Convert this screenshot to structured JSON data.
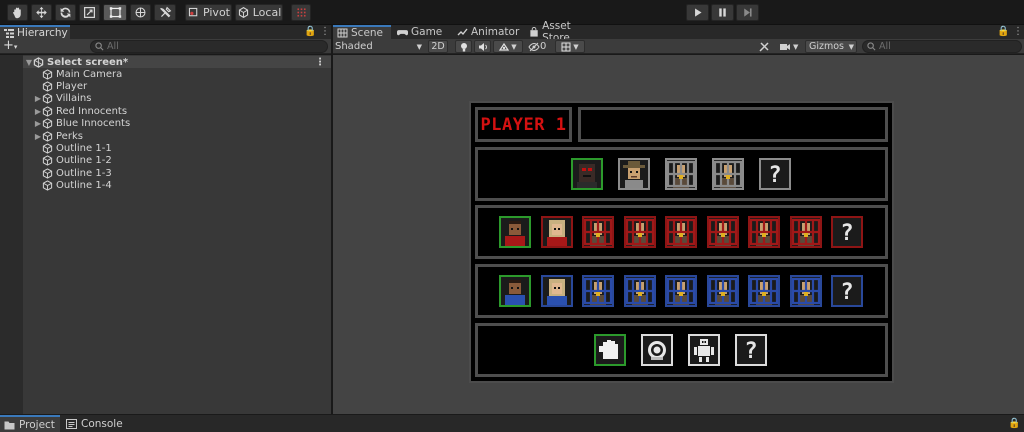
{
  "toolbar": {
    "pivot_label": "Pivot",
    "local_label": "Local"
  },
  "hierarchy": {
    "tab_label": "Hierarchy",
    "add_label": "+",
    "search_placeholder": "All",
    "scene_name": "Select screen*",
    "items": [
      {
        "label": "Main Camera",
        "expandable": false
      },
      {
        "label": "Player",
        "expandable": false
      },
      {
        "label": "Villains",
        "expandable": true
      },
      {
        "label": "Red Innocents",
        "expandable": true
      },
      {
        "label": "Blue Innocents",
        "expandable": true
      },
      {
        "label": "Perks",
        "expandable": true
      },
      {
        "label": "Outline 1-1",
        "expandable": false
      },
      {
        "label": "Outline 1-2",
        "expandable": false
      },
      {
        "label": "Outline 1-3",
        "expandable": false
      },
      {
        "label": "Outline 1-4",
        "expandable": false
      }
    ]
  },
  "scene": {
    "tabs": [
      "Scene",
      "Game",
      "Animator",
      "Asset Store"
    ],
    "shading_mode": "Shaded",
    "mode_2d_label": "2D",
    "hidden_count": "0",
    "gizmos_label": "Gizmos",
    "search_placeholder": "All"
  },
  "game_ui": {
    "player_label": "PLAYER 1",
    "player_label_color": "#d41111",
    "villains": [
      "face-selected",
      "cowboy",
      "caged",
      "caged",
      "unknown"
    ],
    "red_innocents": [
      "red-man-selected",
      "red-woman",
      "caged",
      "caged",
      "caged",
      "caged",
      "caged",
      "caged",
      "unknown"
    ],
    "blue_innocents": [
      "blue-man-selected",
      "blue-woman",
      "caged",
      "caged",
      "caged",
      "caged",
      "caged",
      "caged",
      "unknown"
    ],
    "perks": [
      "fist-selected",
      "coin",
      "robot",
      "unknown"
    ]
  },
  "bottom": {
    "tabs": [
      "Project",
      "Console"
    ]
  },
  "colors": {
    "accent": "#3a79bb",
    "selected_green": "#2c9a2c",
    "red_frame": "#8e1515",
    "blue_frame": "#29489a"
  }
}
